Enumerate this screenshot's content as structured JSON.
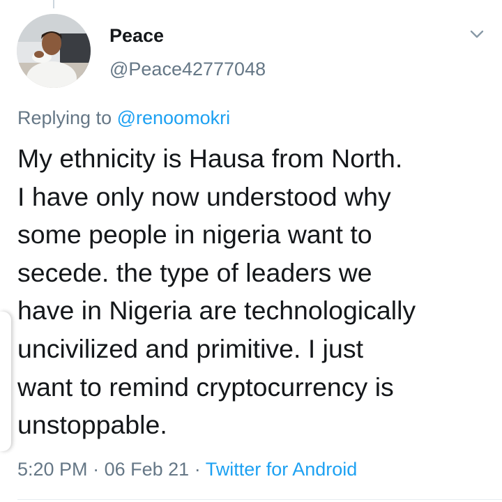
{
  "author": {
    "display_name": "Peace",
    "handle": "@Peace42777048",
    "avatar_icon": "profile-photo"
  },
  "reply": {
    "prefix": "Replying to",
    "to_handle": "@renoomokri"
  },
  "tweet": {
    "text": "My ethnicity is Hausa from North.\nI have only now understood why\nsome people in nigeria want to\nsecede. the type of leaders we\nhave in Nigeria are technologically\nuncivilized and primitive. I just\nwant to remind cryptocurrency is\nunstoppable."
  },
  "meta": {
    "time": "5:20 PM",
    "separator": "·",
    "date": "06 Feb 21",
    "source": "Twitter for Android"
  },
  "colors": {
    "primary_text": "#14171a",
    "secondary_text": "#657786",
    "link": "#1da1f2",
    "divider": "#e6ecf0"
  },
  "icons": {
    "menu": "chevron-down-icon"
  }
}
